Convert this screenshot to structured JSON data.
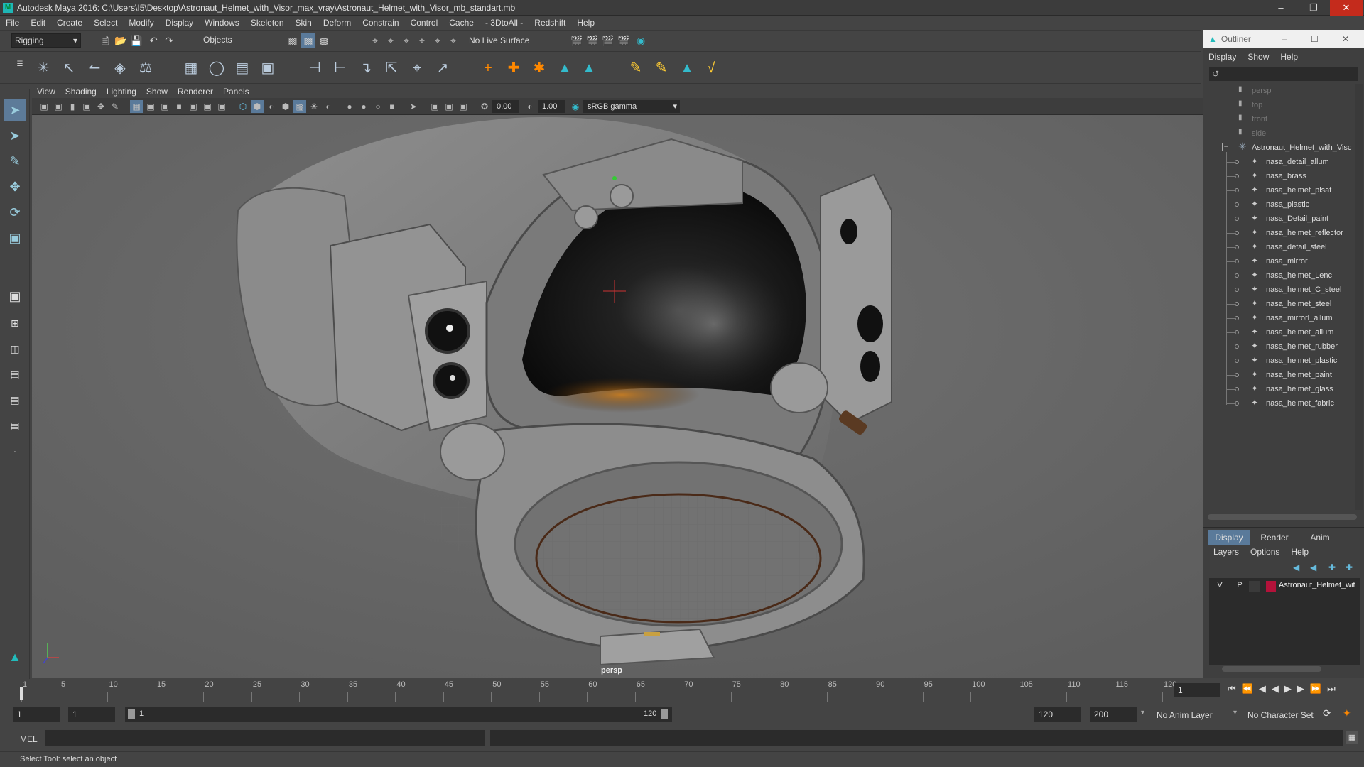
{
  "title": "Autodesk Maya 2016: C:\\Users\\I5\\Desktop\\Astronaut_Helmet_with_Visor_max_vray\\Astronaut_Helmet_with_Visor_mb_standart.mb",
  "menu": [
    "File",
    "Edit",
    "Create",
    "Select",
    "Modify",
    "Display",
    "Windows",
    "Skeleton",
    "Skin",
    "Deform",
    "Constrain",
    "Control",
    "Cache",
    "- 3DtoAll -",
    "Redshift",
    "Help"
  ],
  "status_line": {
    "mode": "Rigging",
    "selection_mask": "Objects",
    "live_surface": "No Live Surface"
  },
  "viewport": {
    "menu": [
      "View",
      "Shading",
      "Lighting",
      "Show",
      "Renderer",
      "Panels"
    ],
    "exposure": "0.00",
    "gamma": "1.00",
    "color_space": "sRGB gamma",
    "camera_label": "persp"
  },
  "outliner": {
    "title": "Outliner",
    "menu": [
      "Display",
      "Show",
      "Help"
    ],
    "cameras": [
      "persp",
      "top",
      "front",
      "side"
    ],
    "root": "Astronaut_Helmet_with_Visc",
    "children": [
      "nasa_detail_allum",
      "nasa_brass",
      "nasa_helmet_plsat",
      "nasa_plastic",
      "nasa_Detail_paint",
      "nasa_helmet_reflector",
      "nasa_detail_steel",
      "nasa_mirror",
      "nasa_helmet_Lenc",
      "nasa_helmet_C_steel",
      "nasa_helmet_steel",
      "nasa_mirrorl_allum",
      "nasa_helmet_allum",
      "nasa_helmet_rubber",
      "nasa_helmet_plastic",
      "nasa_helmet_paint",
      "nasa_helmet_glass",
      "nasa_helmet_fabric"
    ]
  },
  "layer_editor": {
    "tabs": [
      "Display",
      "Render",
      "Anim"
    ],
    "menu": [
      "Layers",
      "Options",
      "Help"
    ],
    "layer": {
      "v": "V",
      "p": "P",
      "name": "Astronaut_Helmet_wit",
      "color": "#b3123a"
    }
  },
  "timeline": {
    "ticks": [
      "1",
      "5",
      "10",
      "15",
      "20",
      "25",
      "30",
      "35",
      "40",
      "45",
      "50",
      "55",
      "60",
      "65",
      "70",
      "75",
      "80",
      "85",
      "90",
      "95",
      "100",
      "105",
      "110",
      "115",
      "120"
    ],
    "current_frame": "1"
  },
  "range": {
    "start": "1",
    "playback_start": "1",
    "slider_start": "1",
    "slider_end": "120",
    "playback_end": "120",
    "end": "200",
    "anim_layer": "No Anim Layer",
    "character_set": "No Character Set"
  },
  "command_line": {
    "label": "MEL"
  },
  "help_line": "Select Tool: select an object"
}
